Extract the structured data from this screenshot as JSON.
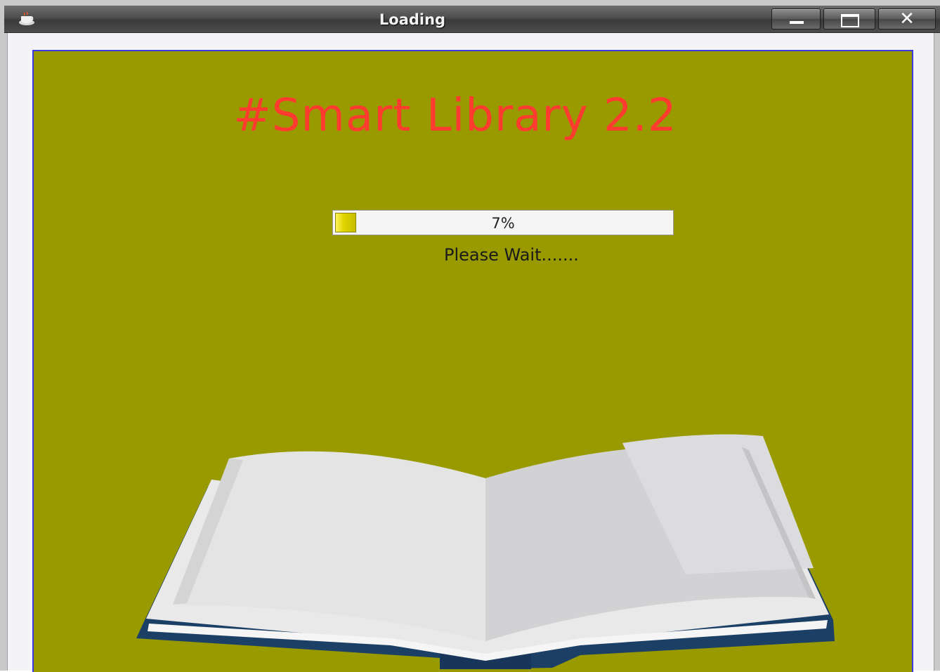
{
  "window": {
    "title": "Loading",
    "icon": "java-coffee-cup-icon",
    "buttons": {
      "minimize": "minimize-icon",
      "maximize": "maximize-icon",
      "close": "close-icon"
    }
  },
  "content": {
    "background": "#989a00",
    "app_title": "#Smart Library 2.2",
    "app_title_color": "#ff3b30",
    "progress": {
      "percent": 7,
      "label": "7%"
    },
    "status": "Please Wait.......",
    "illustration": "open-book-icon"
  }
}
